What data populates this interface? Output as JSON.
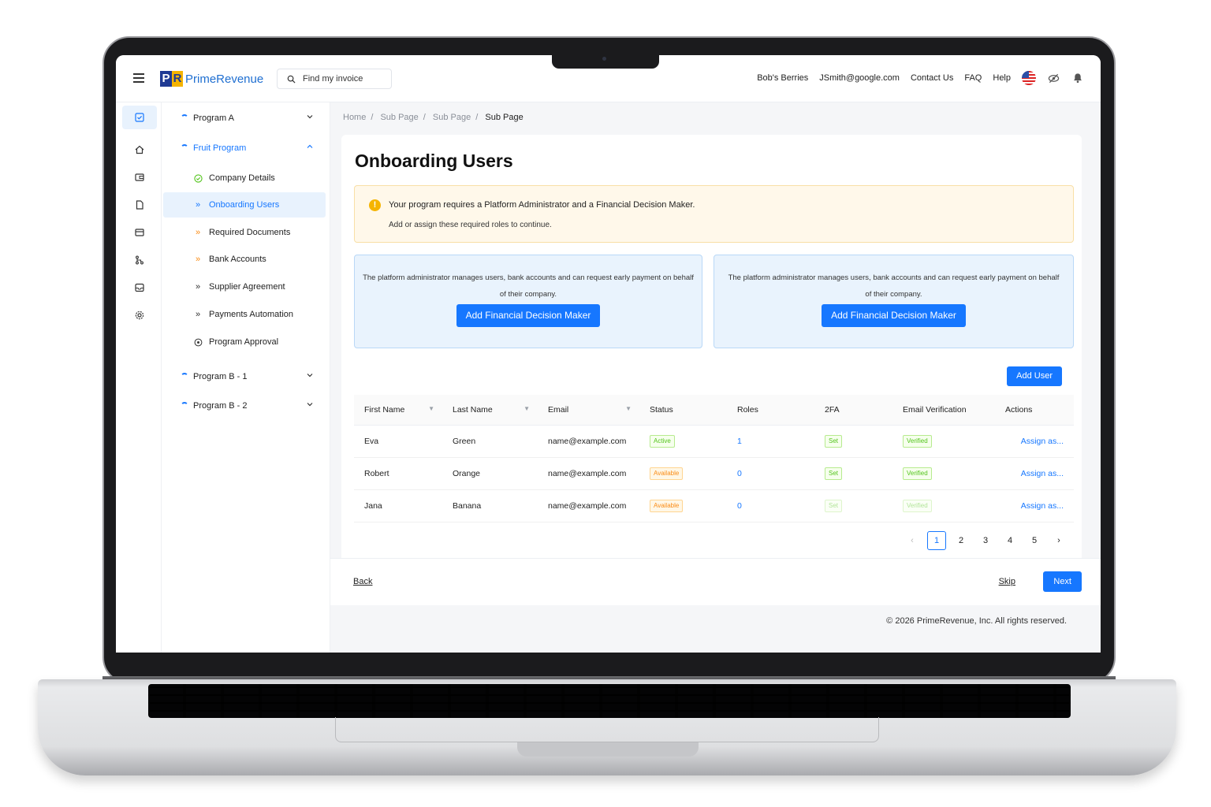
{
  "header": {
    "brand": "PrimeRevenue",
    "logo_letters": "PR",
    "search_placeholder": "Find my invoice",
    "nav": [
      "Bob's Berries",
      "JSmith@google.com",
      "Contact Us",
      "FAQ",
      "Help"
    ]
  },
  "sidebar": {
    "programs": {
      "program_a": "Program A",
      "fruit": "Fruit Program",
      "program_b1": "Program B - 1",
      "program_b2": "Program B - 2"
    },
    "steps": [
      {
        "label": "Company Details",
        "icon": "check-circle-icon"
      },
      {
        "label": "Onboarding Users",
        "icon": "double-chevron-icon"
      },
      {
        "label": "Required Documents",
        "icon": "double-chevron-icon"
      },
      {
        "label": "Bank Accounts",
        "icon": "double-chevron-icon"
      },
      {
        "label": "Supplier Agreement",
        "icon": "double-chevron-icon"
      },
      {
        "label": "Payments Automation",
        "icon": "double-chevron-icon"
      },
      {
        "label": "Program Approval",
        "icon": "target-icon"
      }
    ]
  },
  "breadcrumb": [
    "Home",
    "Sub Page",
    "Sub Page",
    "Sub Page"
  ],
  "page": {
    "title": "Onboarding Users",
    "alert_title": "Your program requires a Platform Administrator and a Financial Decision Maker.",
    "alert_desc": "Add or assign these required roles to continue.",
    "role_cards": [
      {
        "text": "The platform administrator manages users, bank accounts and can request early payment on behalf of their company.",
        "button": "Add Financial Decision Maker"
      },
      {
        "text": "The platform administrator manages users, bank accounts and can request early payment on behalf of their company.",
        "button": "Add Financial Decision Maker"
      }
    ],
    "add_user": "Add User"
  },
  "table": {
    "headers": [
      "First Name",
      "Last Name",
      "Email",
      "Status",
      "Roles",
      "2FA",
      "Email Verification",
      "Actions"
    ],
    "rows": [
      {
        "first": "Eva",
        "last": "Green",
        "email": "name@example.com",
        "status": "Active",
        "roles": "1",
        "twofa": "Set",
        "verification": "Verified",
        "action": "Assign as..."
      },
      {
        "first": "Robert",
        "last": "Orange",
        "email": "name@example.com",
        "status": "Available",
        "roles": "0",
        "twofa": "Set",
        "verification": "Verified",
        "action": "Assign as..."
      },
      {
        "first": "Jana",
        "last": "Banana",
        "email": "name@example.com",
        "status": "Available",
        "roles": "0",
        "twofa": "Set",
        "verification": "Verified",
        "action": "Assign as..."
      }
    ]
  },
  "pagination": {
    "current": "1",
    "pages": [
      "1",
      "2",
      "3",
      "4",
      "5"
    ]
  },
  "footer": {
    "back": "Back",
    "skip": "Skip",
    "next": "Next",
    "copyright": "© 2026 PrimeRevenue, Inc. All rights reserved."
  },
  "colors": {
    "accent": "#1677ff",
    "brand_blue": "#1f3a93",
    "brand_yellow": "#f5b400",
    "warning_bg": "#fff8ea"
  }
}
